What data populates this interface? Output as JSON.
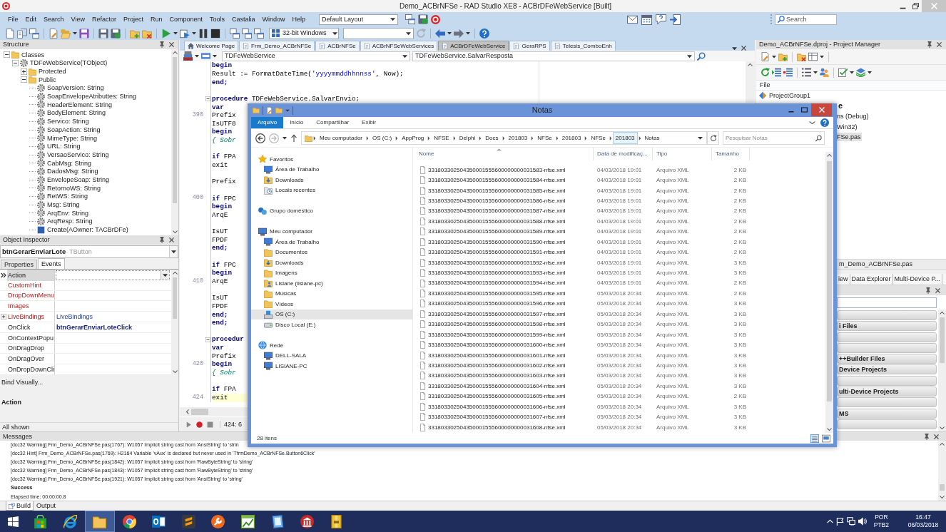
{
  "window": {
    "title": "Demo_ACBrNFSe - RAD Studio XE8 - ACBrDFeWebService [Built]"
  },
  "menu": [
    "File",
    "Edit",
    "Search",
    "View",
    "Refactor",
    "Project",
    "Run",
    "Component",
    "Tools",
    "Castalia",
    "Window",
    "Help"
  ],
  "layout_combo": {
    "value": "Default Layout"
  },
  "search": {
    "placeholder": "Search"
  },
  "platform_combo": {
    "value": "32-bit Windows"
  },
  "structure": {
    "title": "Structure",
    "tree": [
      {
        "label": "Classes",
        "kind": "folder",
        "expanded": true,
        "children": [
          {
            "label": "TDFeWebService(TObject)",
            "kind": "class",
            "expanded": true,
            "children": [
              {
                "label": "Protected",
                "kind": "folder",
                "expanded": false
              },
              {
                "label": "Public",
                "kind": "folder",
                "expanded": true,
                "children": [
                  {
                    "label": "SoapVersion: String",
                    "kind": "member"
                  },
                  {
                    "label": "SoapEnvelopeAtributtes: String",
                    "kind": "member"
                  },
                  {
                    "label": "HeaderElement: String",
                    "kind": "member"
                  },
                  {
                    "label": "BodyElement: String",
                    "kind": "member"
                  },
                  {
                    "label": "Servico: String",
                    "kind": "member"
                  },
                  {
                    "label": "SoapAction: String",
                    "kind": "member"
                  },
                  {
                    "label": "MimeType: String",
                    "kind": "member"
                  },
                  {
                    "label": "URL: String",
                    "kind": "member"
                  },
                  {
                    "label": "VersaoServico: String",
                    "kind": "member"
                  },
                  {
                    "label": "CabMsg: String",
                    "kind": "member"
                  },
                  {
                    "label": "DadosMsg: String",
                    "kind": "member"
                  },
                  {
                    "label": "EnvelopeSoap: String",
                    "kind": "member"
                  },
                  {
                    "label": "RetornoWS: String",
                    "kind": "member"
                  },
                  {
                    "label": "RetWS: String",
                    "kind": "member"
                  },
                  {
                    "label": "Msg: String",
                    "kind": "member"
                  },
                  {
                    "label": "ArqEnv: String",
                    "kind": "member"
                  },
                  {
                    "label": "ArqResp: String",
                    "kind": "member"
                  },
                  {
                    "label": "Create(AOwner: TACBrDFe)",
                    "kind": "method"
                  }
                ]
              }
            ]
          }
        ]
      }
    ]
  },
  "object_inspector": {
    "title": "Object Inspector",
    "object": "btnGerarEnviarLote",
    "type": "TButton",
    "tabs": [
      {
        "label": "Properties",
        "selected": false
      },
      {
        "label": "Events",
        "selected": true
      }
    ],
    "rows": [
      {
        "name": "Action",
        "kind": "reference",
        "selected": true
      },
      {
        "name": "CustomHint",
        "kind": "reference",
        "selected": false
      },
      {
        "name": "DropDownMenu",
        "kind": "reference",
        "selected": false
      },
      {
        "name": "Images",
        "kind": "reference",
        "selected": false
      },
      {
        "name": "LiveBindings",
        "kind": "reference",
        "value": "LiveBindings",
        "expanded": false,
        "selected": false
      },
      {
        "name": "OnClick",
        "kind": "event",
        "value": "btnGerarEnviarLoteClick",
        "selected": false
      },
      {
        "name": "OnContextPopu",
        "kind": "event",
        "selected": false
      },
      {
        "name": "OnDragDrop",
        "kind": "event",
        "selected": false
      },
      {
        "name": "OnDragOver",
        "kind": "event",
        "selected": false
      },
      {
        "name": "OnDropDownCli",
        "kind": "event",
        "selected": false
      }
    ],
    "bind_link": "Bind Visually...",
    "description": "Action",
    "status": "All shown"
  },
  "editor": {
    "tabs": [
      {
        "label": "Welcome Page",
        "kind": "welcome",
        "selected": false
      },
      {
        "label": "Frm_Demo_ACBrNFSe",
        "kind": "unit",
        "selected": false
      },
      {
        "label": "ACBrNFSe",
        "kind": "unit",
        "selected": false
      },
      {
        "label": "ACBrNFSeWebServices",
        "kind": "unit",
        "selected": false
      },
      {
        "label": "ACBrDFeWebService",
        "kind": "unit",
        "selected": true
      },
      {
        "label": "GeraRPS",
        "kind": "unit",
        "selected": false
      },
      {
        "label": "Telesis_ComboEnh",
        "kind": "unit",
        "selected": false
      }
    ],
    "class_combo": "TDFeWebService",
    "method_combo": "TDFeWebService.SalvarResposta",
    "lines": [
      {
        "segments": [
          {
            "kind": "keyword",
            "text": "begin"
          }
        ],
        "current": false
      },
      {
        "segments": [
          {
            "kind": "plain",
            "text": "  Result := FormatDateTime("
          },
          {
            "kind": "string",
            "text": "'yyyymmddhhnnss'"
          },
          {
            "kind": "plain",
            "text": ", Now);"
          }
        ],
        "current": false
      },
      {
        "segments": [
          {
            "kind": "keyword",
            "text": "end;"
          }
        ],
        "current": false
      },
      {
        "current": false
      },
      {
        "segments": [
          {
            "kind": "keyword",
            "text": "procedure"
          },
          {
            "kind": "plain",
            "text": " TDFeWebService.SalvarEnvio;"
          }
        ],
        "foldable": true,
        "current": false
      },
      {
        "segments": [
          {
            "kind": "keyword",
            "text": "var"
          }
        ],
        "current": false
      },
      {
        "number": "390",
        "segments": [
          {
            "kind": "plain",
            "text": "  Prefix"
          }
        ],
        "current": false
      },
      {
        "segments": [
          {
            "kind": "plain",
            "text": "  IsUTF8"
          }
        ],
        "current": false
      },
      {
        "segments": [
          {
            "kind": "keyword",
            "text": "begin"
          }
        ],
        "current": false
      },
      {
        "segments": [
          {
            "kind": "comment",
            "text": "  { Sobr"
          }
        ],
        "current": false
      },
      {
        "current": false
      },
      {
        "segments": [
          {
            "kind": "keyword",
            "text": "  if"
          },
          {
            "kind": "plain",
            "text": " FPA"
          }
        ],
        "current": false
      },
      {
        "segments": [
          {
            "kind": "plain",
            "text": "    exit"
          }
        ],
        "current": false
      },
      {
        "current": false
      },
      {
        "segments": [
          {
            "kind": "plain",
            "text": "  Prefix"
          }
        ],
        "current": false
      },
      {
        "current": false
      },
      {
        "number": "400",
        "segments": [
          {
            "kind": "keyword",
            "text": "  if"
          },
          {
            "kind": "plain",
            "text": " FPC"
          }
        ],
        "current": false
      },
      {
        "segments": [
          {
            "kind": "keyword",
            "text": "  begin"
          }
        ],
        "current": false
      },
      {
        "segments": [
          {
            "kind": "plain",
            "text": "    ArqE"
          }
        ],
        "current": false
      },
      {
        "current": false
      },
      {
        "segments": [
          {
            "kind": "plain",
            "text": "    IsUT"
          }
        ],
        "current": false
      },
      {
        "segments": [
          {
            "kind": "plain",
            "text": "    FPDF"
          }
        ],
        "current": false
      },
      {
        "segments": [
          {
            "kind": "keyword",
            "text": "  end;"
          }
        ],
        "current": false
      },
      {
        "current": false
      },
      {
        "segments": [
          {
            "kind": "keyword",
            "text": "  if"
          },
          {
            "kind": "plain",
            "text": " FPC"
          }
        ],
        "current": false
      },
      {
        "segments": [
          {
            "kind": "keyword",
            "text": "  begin"
          }
        ],
        "current": false
      },
      {
        "number": "410",
        "segments": [
          {
            "kind": "plain",
            "text": "    ArqE"
          }
        ],
        "current": false
      },
      {
        "current": false
      },
      {
        "segments": [
          {
            "kind": "plain",
            "text": "    IsUT"
          }
        ],
        "current": false
      },
      {
        "segments": [
          {
            "kind": "plain",
            "text": "    FPDF"
          }
        ],
        "current": false
      },
      {
        "segments": [
          {
            "kind": "keyword",
            "text": "  end;"
          }
        ],
        "current": false
      },
      {
        "segments": [
          {
            "kind": "keyword",
            "text": "end;"
          }
        ],
        "current": false
      },
      {
        "current": false
      },
      {
        "segments": [
          {
            "kind": "keyword",
            "text": "procedur"
          }
        ],
        "foldable": true,
        "current": false
      },
      {
        "segments": [
          {
            "kind": "keyword",
            "text": "var"
          }
        ],
        "current": false
      },
      {
        "segments": [
          {
            "kind": "plain",
            "text": "  Prefix"
          }
        ],
        "current": false
      },
      {
        "number": "420",
        "segments": [
          {
            "kind": "keyword",
            "text": "begin"
          }
        ],
        "current": false
      },
      {
        "segments": [
          {
            "kind": "comment",
            "text": "  { Sobr"
          }
        ],
        "current": false
      },
      {
        "current": false
      },
      {
        "segments": [
          {
            "kind": "keyword",
            "text": "  if"
          },
          {
            "kind": "plain",
            "text": " FPA"
          }
        ],
        "current": false
      },
      {
        "number": "424",
        "segments": [
          {
            "kind": "plain",
            "text": "    exit"
          }
        ],
        "current": true
      }
    ],
    "position": "424: 6"
  },
  "project_manager": {
    "title": "Demo_ACBrNFSe.dproj - Project Manager",
    "column": "File",
    "items": [
      {
        "label": "ProjectGroup1",
        "kind": "group",
        "selected": false
      },
      {
        "label": "e",
        "kind": "project",
        "selected": false
      },
      {
        "label": "ns (Debug)",
        "kind": "node",
        "selected": false
      },
      {
        "label": "Win32)",
        "kind": "node",
        "selected": false
      },
      {
        "label": "FSe.pas",
        "kind": "node",
        "selected": true
      }
    ]
  },
  "file_bar": "m_Demo_ACBrNFSe.pas",
  "side_tabs": [
    {
      "label": "iew"
    },
    {
      "label": "Data Explorer"
    },
    {
      "label": "Multi-Device P..."
    }
  ],
  "tool_palette": {
    "categories": [
      {
        "expanded": false
      },
      {
        "label": "i Files",
        "expanded": false
      },
      {
        "expanded": false
      },
      {
        "expanded": false
      },
      {
        "label": "++Builder Files",
        "expanded": false
      },
      {
        "label": "Device Projects",
        "expanded": false
      },
      {
        "expanded": false
      },
      {
        "label": "ulti-Device Projects",
        "expanded": false
      },
      {
        "expanded": false
      },
      {
        "label": "MS",
        "expanded": false
      },
      {
        "expanded": false
      }
    ]
  },
  "messages": {
    "title": "Messages",
    "lines": [
      {
        "kind": "message",
        "text": "[dcc32 Warning] Frm_Demo_ACBrNFSe.pas(1767): W1057 Implicit string cast from 'AnsiString' to 'strin"
      },
      {
        "kind": "message",
        "text": "[dcc32 Hint] Frm_Demo_ACBrNFSe.pas(1769): H2164 Variable 'vAux' is declared but never used in 'TfrmDemo_ACBrNFSe.Button6Click'"
      },
      {
        "kind": "message",
        "text": "[dcc32 Warning] Frm_Demo_ACBrNFSe.pas(1842): W1057 Implicit string cast from 'RawByteString' to 'string'"
      },
      {
        "kind": "message",
        "text": "[dcc32 Warning] Frm_Demo_ACBrNFSe.pas(1843): W1057 Implicit string cast from 'RawByteString' to 'string'"
      },
      {
        "kind": "message",
        "text": "[dcc32 Warning] Frm_Demo_ACBrNFSe.pas(1921): W1057 Implicit string cast from 'AnsiString' to 'string'"
      },
      {
        "kind": "result",
        "text": "Success"
      },
      {
        "kind": "message",
        "text": "Elapsed time: 00:00:00.8"
      }
    ]
  },
  "bottom_tabs": [
    {
      "label": "Build",
      "selected": true
    },
    {
      "label": "Output",
      "selected": false
    }
  ],
  "taskbar": {
    "apps": [
      {
        "active": false
      },
      {
        "active": false
      },
      {
        "active": true
      },
      {
        "active": false
      },
      {
        "active": false
      },
      {
        "active": false
      },
      {
        "active": false
      },
      {
        "active": false
      },
      {
        "active": false
      },
      {
        "active": false
      },
      {
        "active": false
      }
    ],
    "language": "POR",
    "keyboard": "PTB2",
    "time": "16:47",
    "date": "06/03/2018"
  },
  "explorer": {
    "title": "Notas",
    "ribbon_tabs": [
      {
        "label": "Arquivo",
        "selected": true
      },
      {
        "label": "Início",
        "selected": false
      },
      {
        "label": "Compartilhar",
        "selected": false
      },
      {
        "label": "Exibir",
        "selected": false
      }
    ],
    "path": [
      {
        "label": "Meu computador",
        "hovered": false
      },
      {
        "label": "OS (C:)",
        "hovered": false
      },
      {
        "label": "AppProg",
        "hovered": false
      },
      {
        "label": "NFSE",
        "hovered": false
      },
      {
        "label": "Delphi",
        "hovered": false
      },
      {
        "label": "Docs",
        "hovered": false
      },
      {
        "label": "201803",
        "hovered": false
      },
      {
        "label": "NFSe",
        "hovered": false
      },
      {
        "label": "201803",
        "hovered": false
      },
      {
        "label": "NFSe",
        "hovered": false
      },
      {
        "label": "201803",
        "hovered": true
      },
      {
        "label": "Notas",
        "hovered": false
      }
    ],
    "search": {
      "placeholder": "Pesquisar Notas"
    },
    "nav": [
      {
        "label": "Favoritos",
        "kind": "favorites",
        "selected": false,
        "children": [
          {
            "label": "Área de Trabalho",
            "kind": "desktop",
            "selected": false
          },
          {
            "label": "Downloads",
            "kind": "downloads",
            "selected": false
          },
          {
            "label": "Locais recentes",
            "kind": "recent",
            "selected": false
          }
        ]
      },
      {
        "label": "Grupo doméstico",
        "kind": "homegroup",
        "selected": false
      },
      {
        "label": "Meu computador",
        "kind": "computer",
        "selected": false,
        "children": [
          {
            "label": "Área de Trabalho",
            "kind": "desktop",
            "selected": false
          },
          {
            "label": "Documentos",
            "kind": "folder",
            "selected": false
          },
          {
            "label": "Downloads",
            "kind": "downloads",
            "selected": false
          },
          {
            "label": "Imagens",
            "kind": "folder",
            "selected": false
          },
          {
            "label": "Lisiane (lisiane-pc)",
            "kind": "user",
            "selected": false
          },
          {
            "label": "Músicas",
            "kind": "folder",
            "selected": false
          },
          {
            "label": "Vídeos",
            "kind": "folder",
            "selected": false
          },
          {
            "label": "OS (C:)",
            "kind": "drive",
            "selected": true
          },
          {
            "label": "Disco Local (E:)",
            "kind": "disk",
            "selected": false
          }
        ]
      },
      {
        "label": "Rede",
        "kind": "network",
        "selected": false,
        "children": [
          {
            "label": "DELL-SALA",
            "kind": "pc",
            "selected": false
          },
          {
            "label": "LISIANE-PC",
            "kind": "pc",
            "selected": false
          }
        ]
      }
    ],
    "columns": [
      "Nome",
      "Data de modificaç...",
      "Tipo",
      "Tamanho"
    ],
    "files": [
      {
        "name": "331803302504350001555600000000031583-nfse.xml",
        "date": "04/03/2018 19:01",
        "type": "Arquivo XML",
        "size": "2 KB"
      },
      {
        "name": "331803302504350001555600000000031584-nfse.xml",
        "date": "04/03/2018 19:01",
        "type": "Arquivo XML",
        "size": "2 KB"
      },
      {
        "name": "331803302504350001555600000000031585-nfse.xml",
        "date": "04/03/2018 19:01",
        "type": "Arquivo XML",
        "size": "2 KB"
      },
      {
        "name": "331803302504350001555600000000031586-nfse.xml",
        "date": "04/03/2018 19:01",
        "type": "Arquivo XML",
        "size": "2 KB"
      },
      {
        "name": "331803302504350001555600000000031587-nfse.xml",
        "date": "04/03/2018 19:01",
        "type": "Arquivo XML",
        "size": "2 KB"
      },
      {
        "name": "331803302504350001555600000000031588-nfse.xml",
        "date": "04/03/2018 19:01",
        "type": "Arquivo XML",
        "size": "2 KB"
      },
      {
        "name": "331803302504350001555600000000031589-nfse.xml",
        "date": "04/03/2018 19:01",
        "type": "Arquivo XML",
        "size": "2 KB"
      },
      {
        "name": "331803302504350001555600000000031590-nfse.xml",
        "date": "04/03/2018 19:01",
        "type": "Arquivo XML",
        "size": "2 KB"
      },
      {
        "name": "331803302504350001555600000000031591-nfse.xml",
        "date": "04/03/2018 19:01",
        "type": "Arquivo XML",
        "size": "2 KB"
      },
      {
        "name": "331803302504350001555600000000031592-nfse.xml",
        "date": "04/03/2018 19:01",
        "type": "Arquivo XML",
        "size": "3 KB"
      },
      {
        "name": "331803302504350001555600000000031593-nfse.xml",
        "date": "04/03/2018 19:01",
        "type": "Arquivo XML",
        "size": "3 KB"
      },
      {
        "name": "331803302504350001555600000000031594-nfse.xml",
        "date": "04/03/2018 19:01",
        "type": "Arquivo XML",
        "size": "2 KB"
      },
      {
        "name": "331803302504350001555600000000031595-nfse.xml",
        "date": "05/03/2018 20:34",
        "type": "Arquivo XML",
        "size": "2 KB"
      },
      {
        "name": "331803302504350001555600000000031596-nfse.xml",
        "date": "05/03/2018 20:34",
        "type": "Arquivo XML",
        "size": "3 KB"
      },
      {
        "name": "331803302504350001555600000000031597-nfse.xml",
        "date": "05/03/2018 20:34",
        "type": "Arquivo XML",
        "size": "3 KB"
      },
      {
        "name": "331803302504350001555600000000031598-nfse.xml",
        "date": "05/03/2018 20:34",
        "type": "Arquivo XML",
        "size": "3 KB"
      },
      {
        "name": "331803302504350001555600000000031599-nfse.xml",
        "date": "05/03/2018 20:34",
        "type": "Arquivo XML",
        "size": "3 KB"
      },
      {
        "name": "331803302504350001555600000000031600-nfse.xml",
        "date": "05/03/2018 20:34",
        "type": "Arquivo XML",
        "size": "3 KB"
      },
      {
        "name": "331803302504350001555600000000031601-nfse.xml",
        "date": "05/03/2018 20:34",
        "type": "Arquivo XML",
        "size": "3 KB"
      },
      {
        "name": "331803302504350001555600000000031602-nfse.xml",
        "date": "05/03/2018 20:34",
        "type": "Arquivo XML",
        "size": "3 KB"
      },
      {
        "name": "331803302504350001555600000000031603-nfse.xml",
        "date": "05/03/2018 20:34",
        "type": "Arquivo XML",
        "size": "3 KB"
      },
      {
        "name": "331803302504350001555600000000031604-nfse.xml",
        "date": "05/03/2018 20:34",
        "type": "Arquivo XML",
        "size": "3 KB"
      },
      {
        "name": "331803302504350001555600000000031605-nfse.xml",
        "date": "05/03/2018 20:34",
        "type": "Arquivo XML",
        "size": "2 KB"
      },
      {
        "name": "331803302504350001555600000000031606-nfse.xml",
        "date": "05/03/2018 20:34",
        "type": "Arquivo XML",
        "size": "3 KB"
      },
      {
        "name": "331803302504350001555600000000031607-nfse.xml",
        "date": "05/03/2018 20:34",
        "type": "Arquivo XML",
        "size": "3 KB"
      },
      {
        "name": "331803302504350001555600000000031608-nfse.xml",
        "date": "05/03/2018 20:34",
        "type": "Arquivo XML",
        "size": "3 KB"
      }
    ],
    "status": "28 itens"
  }
}
